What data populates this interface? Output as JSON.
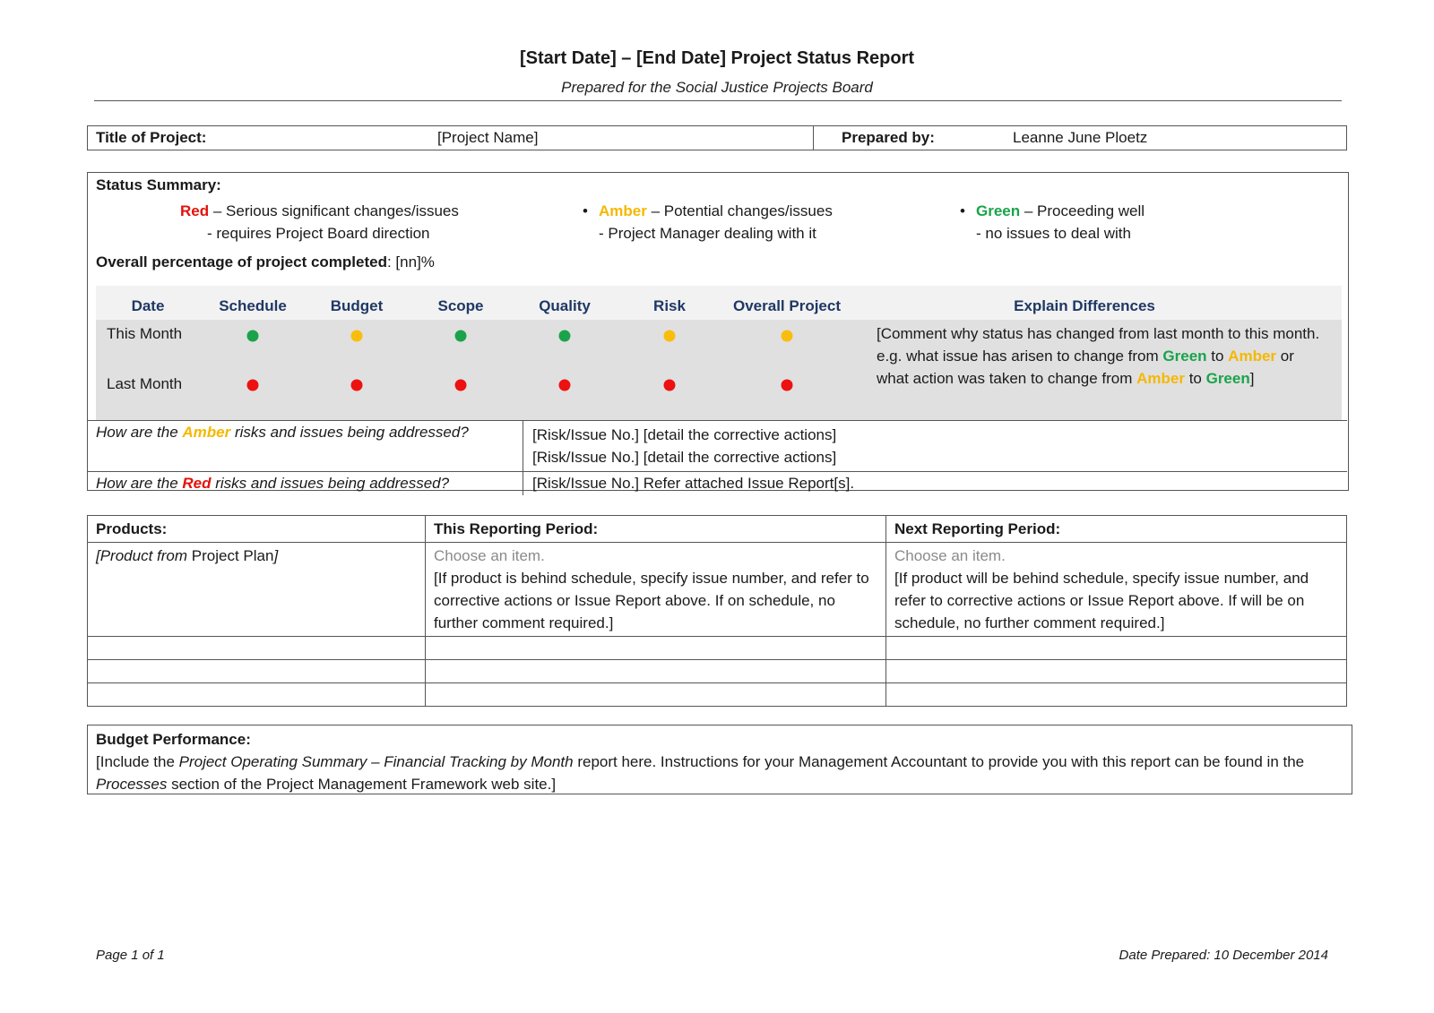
{
  "header": {
    "title": "[Start Date] – [End Date] Project Status Report",
    "subtitle": "Prepared for the Social Justice Projects Board"
  },
  "project": {
    "title_label": "Title of Project:",
    "title_value": "[Project Name]",
    "prepared_by_label": "Prepared by:",
    "prepared_by_value": "Leanne June Ploetz"
  },
  "status_summary": {
    "label": "Status Summary:",
    "legend": [
      {
        "name": "Red",
        "color": "#e3120b",
        "bullet": "",
        "desc": " – Serious significant changes/issues",
        "line2": "- requires Project Board direction"
      },
      {
        "name": "Amber",
        "color": "#f5b800",
        "bullet": "•",
        "desc": " – Potential changes/issues",
        "line2": "- Project Manager dealing with it"
      },
      {
        "name": "Green",
        "color": "#1aa34a",
        "bullet": "•",
        "desc": " – Proceeding well",
        "line2": "- no issues to deal with"
      }
    ],
    "overall_label": "Overall percentage of project completed",
    "overall_value": ":  [nn]%"
  },
  "status_table": {
    "columns": [
      "Date",
      "Schedule",
      "Budget",
      "Scope",
      "Quality",
      "Risk",
      "Overall Project",
      "Explain Differences"
    ],
    "rows": [
      {
        "label": "This Month",
        "statuses": [
          "green",
          "amber",
          "green",
          "green",
          "amber",
          "amber"
        ]
      },
      {
        "label": "Last Month",
        "statuses": [
          "red",
          "red",
          "red",
          "red",
          "red",
          "red"
        ]
      }
    ],
    "status_colors": {
      "green": "#1aa34a",
      "amber": "#f9bd0d",
      "red": "#ed1111"
    },
    "explain": {
      "part1": "[Comment why status has changed from last month to this month.  e.g. what issue has arisen to change from ",
      "green1": "Green",
      "part2": " to ",
      "amber1": "Amber",
      "part3": " or what action was taken to change from ",
      "amber2": "Amber",
      "part4": " to ",
      "green2": "Green",
      "part5": "]"
    }
  },
  "issues": {
    "amber": {
      "q_prefix": "How are the ",
      "q_color_word": "Amber",
      "q_suffix": " risks and issues being addressed?",
      "answers": [
        "[Risk/Issue No.]  [detail the corrective actions]",
        "[Risk/Issue No.]  [detail the corrective actions]"
      ]
    },
    "red": {
      "q_prefix": "How are the ",
      "q_color_word": "Red",
      "q_suffix": " risks and issues being addressed?",
      "answers": [
        "[Risk/Issue No.]  Refer attached Issue Report[s]."
      ]
    }
  },
  "products": {
    "headers": [
      "Products:",
      "This Reporting Period:",
      "Next Reporting Period:"
    ],
    "row": {
      "product_italic": "[Product from ",
      "product_plain": "Project Plan",
      "product_end": "]",
      "this_placeholder": "Choose an item.",
      "this_text": "[If product is behind schedule, specify issue number, and refer to corrective actions or Issue Report above.  If on schedule, no further comment required.]",
      "next_placeholder": "Choose an item.",
      "next_text": "[If product will be behind schedule, specify issue number, and refer to corrective actions or Issue Report above.  If will be on schedule, no further comment required.]"
    }
  },
  "budget": {
    "label": "Budget Performance:",
    "t1": "[Include the ",
    "i1": "Project Operating Summary – Financial Tracking by Month",
    "t2": " report here.  Instructions for your Management Accountant to provide you with this report can be found in the ",
    "i2": "Processes",
    "t3": " section of the Project Management Framework web site.]"
  },
  "footer": {
    "page": "Page 1 of 1",
    "date_prepared": "Date Prepared:  10 December 2014"
  }
}
